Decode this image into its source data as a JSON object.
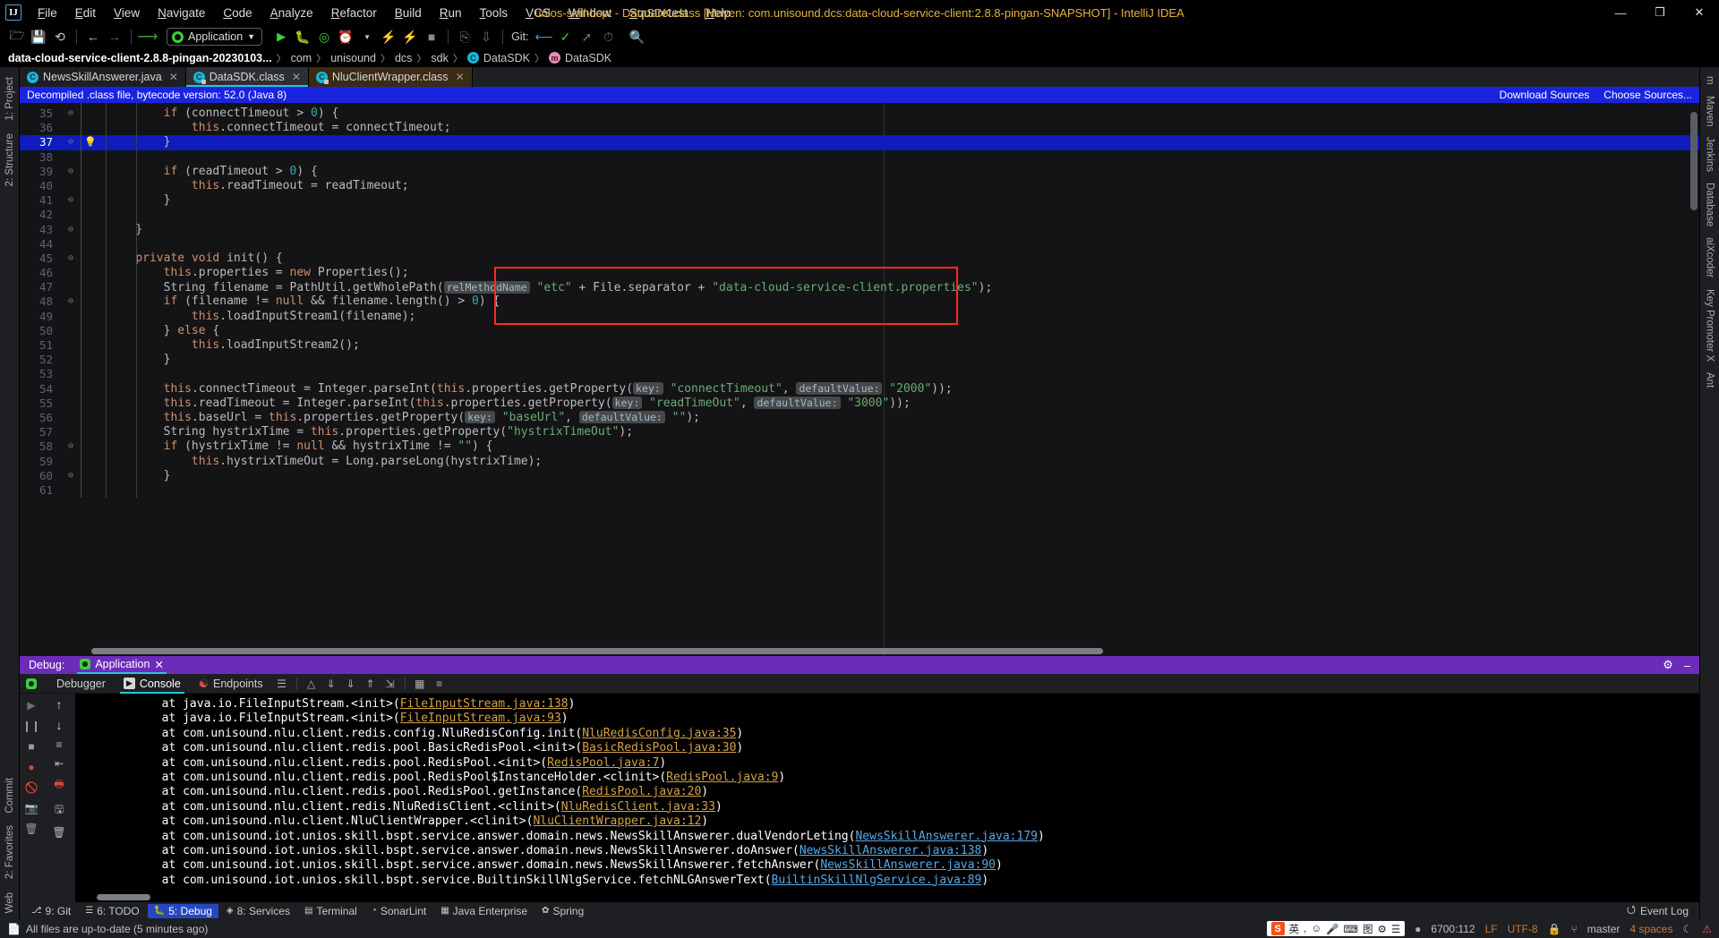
{
  "titlebar": {
    "logo": "IJ",
    "title": "unios-skill-bspt - DataSDK.class [Maven: com.unisound.dcs:data-cloud-service-client:2.8.8-pingan-SNAPSHOT] - IntelliJ IDEA",
    "menu": [
      "File",
      "Edit",
      "View",
      "Navigate",
      "Code",
      "Analyze",
      "Refactor",
      "Build",
      "Run",
      "Tools",
      "VCS",
      "Window",
      "Squaretest",
      "Help"
    ],
    "window_controls": {
      "minimize": "—",
      "maximize": "❐",
      "close": "✕"
    }
  },
  "toolbar": {
    "run_config": "Application",
    "git_label": "Git:",
    "icons": [
      "open-folder-icon",
      "save-icon",
      "sync-icon",
      "back-arrow-icon",
      "forward-arrow-icon",
      "undo-icon",
      "run-icon",
      "debug-icon",
      "run-coverage-icon",
      "profile-icon",
      "build-icon",
      "build-module-icon",
      "stop-icon",
      "update-project-icon",
      "commit-icon",
      "git-pull-icon",
      "git-commit-check-icon",
      "git-push-icon",
      "history-icon",
      "search-icon"
    ]
  },
  "breadcrumb": {
    "root": "data-cloud-service-client-2.8.8-pingan-20230103...",
    "items": [
      "com",
      "unisound",
      "dcs",
      "sdk"
    ],
    "class_badge": "C",
    "class_name": "DataSDK",
    "member_badge": "m",
    "member_name": "DataSDK",
    "separator": "〉"
  },
  "editor_tabs": [
    {
      "label": "NewsSkillAnswerer.java",
      "icon": "java-class-icon",
      "active": false,
      "kind": "java"
    },
    {
      "label": "DataSDK.class",
      "icon": "java-class-locked-icon",
      "active": true,
      "kind": "class"
    },
    {
      "label": "NluClientWrapper.class",
      "icon": "java-class-locked-icon",
      "active": false,
      "kind": "class"
    }
  ],
  "banner": {
    "message": "Decompiled .class file, bytecode version: 52.0 (Java 8)",
    "download_sources": "Download Sources",
    "choose_sources": "Choose Sources..."
  },
  "editor": {
    "highlighted_line": 37,
    "annotation_color": "#ff2a20",
    "lines": [
      {
        "n": 35,
        "fold": "⊖",
        "html": "        <span class=\"kw\">if</span> (connectTimeout &gt; <span class=\"num\">0</span>) {"
      },
      {
        "n": 36,
        "fold": "",
        "html": "            <span class=\"kw\">this</span>.connectTimeout = connectTimeout;"
      },
      {
        "n": 37,
        "fold": "⊖",
        "bulb": true,
        "html": "        }"
      },
      {
        "n": 38,
        "fold": "",
        "html": ""
      },
      {
        "n": 39,
        "fold": "⊖",
        "html": "        <span class=\"kw\">if</span> (readTimeout &gt; <span class=\"num\">0</span>) {"
      },
      {
        "n": 40,
        "fold": "",
        "html": "            <span class=\"kw\">this</span>.readTimeout = readTimeout;"
      },
      {
        "n": 41,
        "fold": "⊖",
        "html": "        }"
      },
      {
        "n": 42,
        "fold": "",
        "html": ""
      },
      {
        "n": 43,
        "fold": "⊖",
        "html": "    }"
      },
      {
        "n": 44,
        "fold": "",
        "html": ""
      },
      {
        "n": 45,
        "fold": "⊖",
        "html": "    <span class=\"kw\">private</span> <span class=\"kw\">void</span> init() {"
      },
      {
        "n": 46,
        "fold": "",
        "html": "        <span class=\"kw\">this</span>.properties = <span class=\"kw\">new</span> Properties();"
      },
      {
        "n": 47,
        "fold": "",
        "html": "        String filename = PathUtil.getWholePath(<span class=\"hint\">relMethodName</span> <span class=\"str\">\"etc\"</span> + File.separator + <span class=\"str\">\"data-cloud-service-client.properties\"</span>);"
      },
      {
        "n": 48,
        "fold": "⊖",
        "html": "        <span class=\"kw\">if</span> (filename != <span class=\"kw\">null</span> &amp;&amp; filename.length() &gt; <span class=\"num\">0</span>) {"
      },
      {
        "n": 49,
        "fold": "",
        "html": "            <span class=\"kw\">this</span>.loadInputStream1(filename);"
      },
      {
        "n": 50,
        "fold": "",
        "html": "        } <span class=\"kw\">else</span> {"
      },
      {
        "n": 51,
        "fold": "",
        "html": "            <span class=\"kw\">this</span>.loadInputStream2();"
      },
      {
        "n": 52,
        "fold": "",
        "html": "        }"
      },
      {
        "n": 53,
        "fold": "",
        "html": ""
      },
      {
        "n": 54,
        "fold": "",
        "html": "        <span class=\"kw\">this</span>.connectTimeout = Integer.parseInt(<span class=\"kw\">this</span>.properties.getProperty(<span class=\"hint\">key:</span> <span class=\"str\">\"connectTimeout\"</span>, <span class=\"hint\">defaultValue:</span> <span class=\"str\">\"2000\"</span>));"
      },
      {
        "n": 55,
        "fold": "",
        "html": "        <span class=\"kw\">this</span>.readTimeout = Integer.parseInt(<span class=\"kw\">this</span>.properties.getProperty(<span class=\"hint\">key:</span> <span class=\"str\">\"readTimeOut\"</span>, <span class=\"hint\">defaultValue:</span> <span class=\"str\">\"3000\"</span>));"
      },
      {
        "n": 56,
        "fold": "",
        "html": "        <span class=\"kw\">this</span>.baseUrl = <span class=\"kw\">this</span>.properties.getProperty(<span class=\"hint\">key:</span> <span class=\"str\">\"baseUrl\"</span>, <span class=\"hint\">defaultValue:</span> <span class=\"str\">\"\"</span>);"
      },
      {
        "n": 57,
        "fold": "",
        "html": "        String hystrixTime = <span class=\"kw\">this</span>.properties.getProperty(<span class=\"str\">\"hystrixTimeOut\"</span>);"
      },
      {
        "n": 58,
        "fold": "⊖",
        "html": "        <span class=\"kw\">if</span> (hystrixTime != <span class=\"kw\">null</span> &amp;&amp; hystrixTime != <span class=\"str\">\"\"</span>) {"
      },
      {
        "n": 59,
        "fold": "",
        "html": "            <span class=\"kw\">this</span>.hystrixTimeOut = Long.parseLong(hystrixTime);"
      },
      {
        "n": 60,
        "fold": "⊖",
        "html": "        }"
      },
      {
        "n": 61,
        "fold": "",
        "html": ""
      }
    ]
  },
  "debug": {
    "title_label": "Debug:",
    "session_tab": "Application",
    "session_close": "✕",
    "settings_icon": "gear-icon",
    "minimize_icon": "minimize-icon",
    "tabs": [
      {
        "label": "Debugger",
        "icon": "debugger-icon",
        "active": false
      },
      {
        "label": "Console",
        "icon": "console-icon",
        "active": true
      },
      {
        "label": "Endpoints",
        "icon": "endpoints-icon",
        "active": false
      }
    ],
    "tools": [
      "layout-icon",
      "soft-wrap-icon",
      "scroll-to-end-icon",
      "print-icon",
      "export-icon",
      "up-icon",
      "down-icon",
      "table-icon",
      "filter-icon"
    ],
    "left_tools": [
      "resume-icon",
      "pause-icon",
      "stop-icon",
      "mute-breakpoints-icon",
      "view-breakpoints-icon",
      "camera-icon",
      "trash-icon"
    ],
    "console_lines": [
      {
        "prefix": "\tat java.io.FileInputStream.<init>(",
        "link": "FileInputStream.java:138",
        "suffix": ")",
        "style": "orange"
      },
      {
        "prefix": "\tat java.io.FileInputStream.<init>(",
        "link": "FileInputStream.java:93",
        "suffix": ")",
        "style": "orange"
      },
      {
        "prefix": "\tat com.unisound.nlu.client.redis.config.NluRedisConfig.init(",
        "link": "NluRedisConfig.java:35",
        "suffix": ")",
        "style": "orange"
      },
      {
        "prefix": "\tat com.unisound.nlu.client.redis.pool.BasicRedisPool.<init>(",
        "link": "BasicRedisPool.java:30",
        "suffix": ")",
        "style": "orange"
      },
      {
        "prefix": "\tat com.unisound.nlu.client.redis.pool.RedisPool.<init>(",
        "link": "RedisPool.java:7",
        "suffix": ")",
        "style": "orange"
      },
      {
        "prefix": "\tat com.unisound.nlu.client.redis.pool.RedisPool$InstanceHolder.<clinit>(",
        "link": "RedisPool.java:9",
        "suffix": ")",
        "style": "orange"
      },
      {
        "prefix": "\tat com.unisound.nlu.client.redis.pool.RedisPool.getInstance(",
        "link": "RedisPool.java:20",
        "suffix": ")",
        "style": "orange"
      },
      {
        "prefix": "\tat com.unisound.nlu.client.redis.NluRedisClient.<clinit>(",
        "link": "NluRedisClient.java:33",
        "suffix": ")",
        "style": "orange"
      },
      {
        "prefix": "\tat com.unisound.nlu.client.NluClientWrapper.<clinit>(",
        "link": "NluClientWrapper.java:12",
        "suffix": ")",
        "style": "orange"
      },
      {
        "prefix": "\tat com.unisound.iot.unios.skill.bspt.service.answer.domain.news.NewsSkillAnswerer.dualVendorLeting(",
        "link": "NewsSkillAnswerer.java:179",
        "suffix": ")",
        "style": "blue"
      },
      {
        "prefix": "\tat com.unisound.iot.unios.skill.bspt.service.answer.domain.news.NewsSkillAnswerer.doAnswer(",
        "link": "NewsSkillAnswerer.java:138",
        "suffix": ")",
        "style": "blue"
      },
      {
        "prefix": "\tat com.unisound.iot.unios.skill.bspt.service.answer.domain.news.NewsSkillAnswerer.fetchAnswer(",
        "link": "NewsSkillAnswerer.java:90",
        "suffix": ")",
        "style": "blue"
      },
      {
        "prefix": "\tat com.unisound.iot.unios.skill.bspt.service.BuiltinSkillNlgService.fetchNLGAnswerText(",
        "link": "BuiltinSkillNlgService.java:89",
        "suffix": ")",
        "style": "blue"
      }
    ]
  },
  "left_rail": [
    {
      "label": "1: Project",
      "icon": "project-icon"
    },
    {
      "label": "2: Structure",
      "icon": "structure-icon"
    },
    {
      "label": "Commit",
      "icon": "commit-icon"
    },
    {
      "label": "2: Favorites",
      "icon": "favorites-icon"
    },
    {
      "label": "Web",
      "icon": "web-icon"
    }
  ],
  "right_rail": [
    {
      "label": "m",
      "icon": "maven-icon"
    },
    {
      "label": "Maven",
      "icon": "maven-icon"
    },
    {
      "label": "Jenkins",
      "icon": "jenkins-icon"
    },
    {
      "label": "Database",
      "icon": "database-icon"
    },
    {
      "label": "aiXcoder",
      "icon": "aixcoder-icon"
    },
    {
      "label": "Key Promoter X",
      "icon": "key-promoter-icon"
    },
    {
      "label": "Ant",
      "icon": "ant-icon"
    }
  ],
  "bottom_tabs": [
    {
      "label": "9: Git",
      "icon": "git-icon",
      "active": false
    },
    {
      "label": "6: TODO",
      "icon": "todo-icon",
      "active": false
    },
    {
      "label": "5: Debug",
      "icon": "debug-icon",
      "active": true
    },
    {
      "label": "8: Services",
      "icon": "services-icon",
      "active": false
    },
    {
      "label": "Terminal",
      "icon": "terminal-icon",
      "active": false
    },
    {
      "label": "SonarLint",
      "icon": "sonarlint-icon",
      "active": false
    },
    {
      "label": "Java Enterprise",
      "icon": "java-enterprise-icon",
      "active": false
    },
    {
      "label": "Spring",
      "icon": "spring-icon",
      "active": false
    }
  ],
  "bottom_right": {
    "label": "Event Log",
    "icon": "event-log-icon"
  },
  "statusbar": {
    "message": "All files are up-to-date (5 minutes ago)",
    "caret": "6700:112",
    "line_sep": "LF",
    "encoding": "UTF-8",
    "branch": "master",
    "indent": "4 spaces",
    "ime": {
      "logo": "S",
      "lang": "英",
      "items": [
        "comma-icon",
        "smiley-icon",
        "mic-icon",
        "keyboard-icon",
        "translate-icon",
        "tools-icon",
        "menu-icon"
      ]
    },
    "icons": [
      "read-only-icon",
      "branch-icon",
      "notifications-icon",
      "inspection-icon"
    ]
  }
}
